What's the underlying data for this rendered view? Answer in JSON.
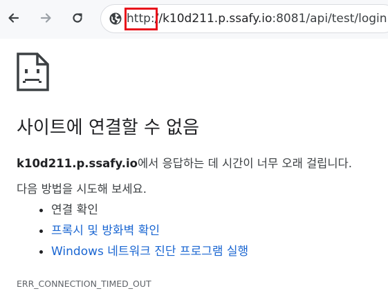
{
  "toolbar": {
    "back_icon": "arrow-left-icon",
    "forward_icon": "arrow-right-icon",
    "reload_icon": "reload-icon",
    "site_info_icon": "globe-icon"
  },
  "address_bar": {
    "scheme": "http:",
    "host": "//k10d211.p.ssafy.io",
    "path": ":8081/api/test/login"
  },
  "error_page": {
    "icon": "sad-page-icon",
    "title": "사이트에 연결할 수 없음",
    "host_bold": "k10d211.p.ssafy.io",
    "description_rest": "에서 응답하는 데 시간이 너무 오래 걸립니다.",
    "try_label": "다음 방법을 시도해 보세요.",
    "suggestions": [
      {
        "label": "연결 확인"
      },
      {
        "label": "프록시 및 방화벽 확인"
      },
      {
        "label": "Windows 네트워크 진단 프로그램 실행"
      }
    ],
    "error_code": "ERR_CONNECTION_TIMED_OUT"
  },
  "colors": {
    "link": "#1a66d2",
    "highlight_box": "#e8121b",
    "toolbar_bg": "#f7f8fa"
  }
}
